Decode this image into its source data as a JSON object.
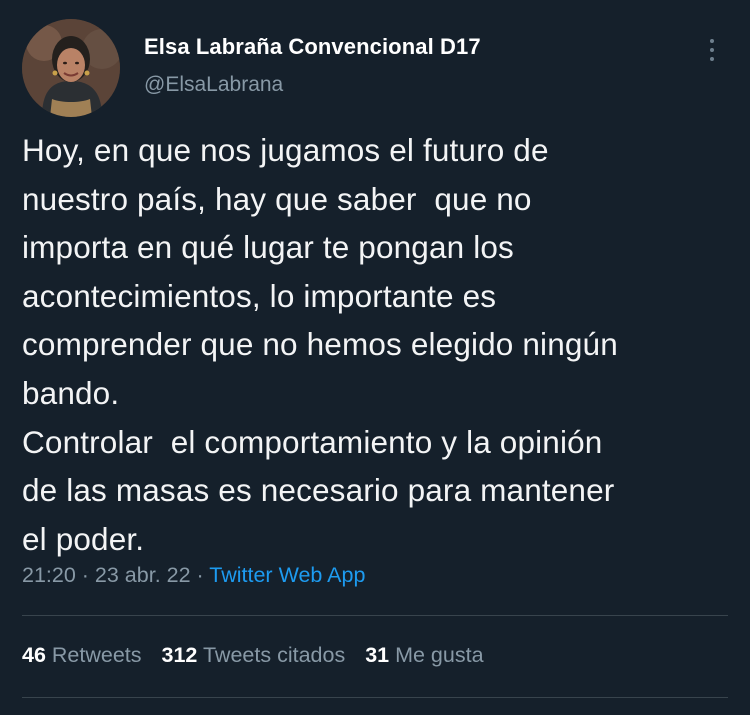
{
  "author": {
    "display_name": "Elsa Labraña Convencional D17",
    "handle": "@ElsaLabrana",
    "avatar_icon": "profile-photo"
  },
  "tweet": {
    "lines": [
      "Hoy, en que nos jugamos el futuro de",
      "nuestro país, hay que saber  que no",
      "importa en qué lugar te pongan los",
      "acontecimientos, lo importante es",
      "comprender que no hemos elegido ningún",
      "bando.",
      "Controlar  el comportamiento y la opinión",
      "de las masas es necesario para mantener",
      "el poder."
    ]
  },
  "meta": {
    "time": "21:20",
    "separator": " · ",
    "date": "23 abr. 22",
    "source": "Twitter Web App"
  },
  "stats": {
    "retweets_count": "46",
    "retweets_label": "Retweets",
    "quotes_count": "312",
    "quotes_label": "Tweets citados",
    "likes_count": "31",
    "likes_label": "Me gusta"
  },
  "colors": {
    "background": "#15202b",
    "secondary_text": "#8899a6",
    "link": "#1d9bf0",
    "divider": "#38444d"
  }
}
